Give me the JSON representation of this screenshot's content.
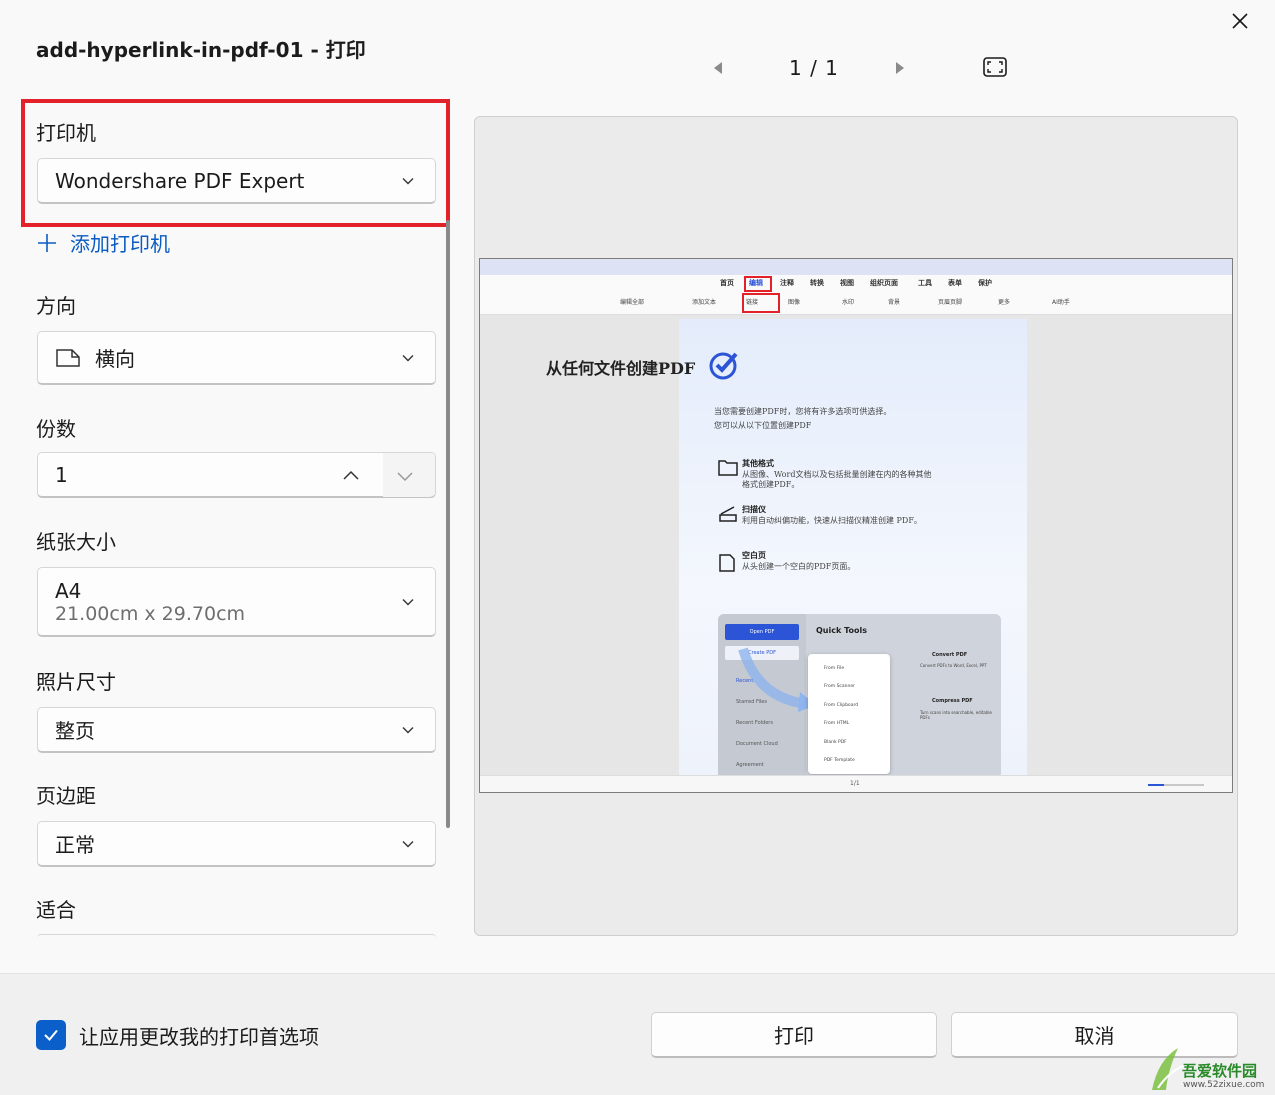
{
  "dialog": {
    "title": "add-hyperlink-in-pdf-01 - 打印",
    "close_icon": "close-icon"
  },
  "settings": {
    "printer": {
      "label": "打印机",
      "value": "Wondershare PDF Expert"
    },
    "add_printer": {
      "icon": "plus-icon",
      "label": "添加打印机"
    },
    "orientation": {
      "label": "方向",
      "value": "横向",
      "icon": "landscape-page-icon"
    },
    "copies": {
      "label": "份数",
      "value": "1"
    },
    "paper_size": {
      "label": "纸张大小",
      "value": "A4",
      "detail": "21.00cm x 29.70cm"
    },
    "photo_size": {
      "label": "照片尺寸",
      "value": "整页"
    },
    "margins": {
      "label": "页边距",
      "value": "正常"
    },
    "fit": {
      "label": "适合"
    }
  },
  "preview": {
    "page_indicator": "1 / 1",
    "doc": {
      "menu": [
        "首页",
        "编辑",
        "注释",
        "转换",
        "视图",
        "组织页面",
        "工具",
        "表单",
        "保护"
      ],
      "tools": [
        "编辑全部",
        "添加文本",
        "链接",
        "图像",
        "水印",
        "背景",
        "页眉页脚",
        "更多",
        "AI助手"
      ],
      "heading": "从任何文件创建PDF",
      "intro": [
        "当您需要创建PDF时，您将有许多选项可供选择。",
        "您可以从以下位置创建PDF"
      ],
      "items": [
        {
          "title": "其他格式",
          "desc": [
            "从图像、Word文档以及包括批量创建在内的各种其他",
            "格式创建PDF。"
          ]
        },
        {
          "title": "扫描仪",
          "desc": [
            "利用自动纠偏功能，快速从扫描仪精准创建 PDF。"
          ]
        },
        {
          "title": "空白页",
          "desc": [
            "从头创建一个空白的PDF页面。"
          ]
        }
      ],
      "card": {
        "open_pdf": "Open PDF",
        "create_pdf": "Create PDF",
        "quick_tools": "Quick Tools",
        "side_links": [
          "Recent",
          "Starred Files",
          "Recent Folders",
          "Document Cloud",
          "Agreement"
        ],
        "popup_items": [
          "From File",
          "From Scanner",
          "From Clipboard",
          "From HTML",
          "Blank PDF",
          "PDF Template"
        ],
        "right_tools": [
          "Convert PDF",
          "Compress PDF"
        ],
        "right_desc": [
          "Convert PDFs to Word, Excel, PPT",
          "Turn scans into searchable, editable PDFs"
        ]
      },
      "status_page": "1/1"
    }
  },
  "footer": {
    "checkbox_label": "让应用更改我的打印首选项",
    "checkbox_checked": true,
    "print_button": "打印",
    "cancel_button": "取消"
  },
  "watermark": {
    "name": "吾爱软件园",
    "url": "www.52zixue.com"
  },
  "colors": {
    "accent": "#0b5fca",
    "highlight": "#e3212a"
  }
}
